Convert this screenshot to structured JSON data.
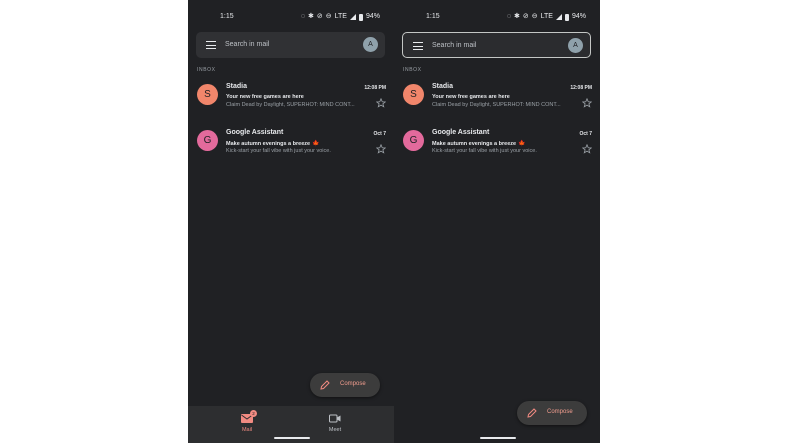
{
  "colors": {
    "background": "#202124",
    "accent": "#f28b82",
    "avatar_stadia": "#f1866b",
    "avatar_google": "#e36a9c",
    "text_primary": "#e8eaed",
    "text_secondary": "#9aa0a6"
  },
  "status_bar": {
    "time": "1:15",
    "network": "LTE",
    "battery": "94%"
  },
  "search": {
    "placeholder": "Search in mail",
    "avatar_initial": "A"
  },
  "inbox": {
    "section_label": "INBOX",
    "emails": [
      {
        "avatar_letter": "S",
        "sender": "Stadia",
        "date": "12:08 PM",
        "subject": "Your new free games are here",
        "snippet": "Claim Dead by Daylight, SUPERHOT: MIND CONT...",
        "starred": false
      },
      {
        "avatar_letter": "G",
        "sender": "Google Assistant",
        "date": "Oct 7",
        "subject": "Make autumn evenings a breeze",
        "subject_emoji": "🍁",
        "snippet": "Kick-start your fall vibe with just your voice.",
        "starred": false
      }
    ]
  },
  "compose": {
    "label": "Compose",
    "icon": "pencil-icon"
  },
  "bottom_nav": {
    "items": [
      {
        "label": "Mail",
        "icon": "mail-icon",
        "badge": "2",
        "selected": true
      },
      {
        "label": "Meet",
        "icon": "video-camera-icon",
        "selected": false
      }
    ]
  }
}
